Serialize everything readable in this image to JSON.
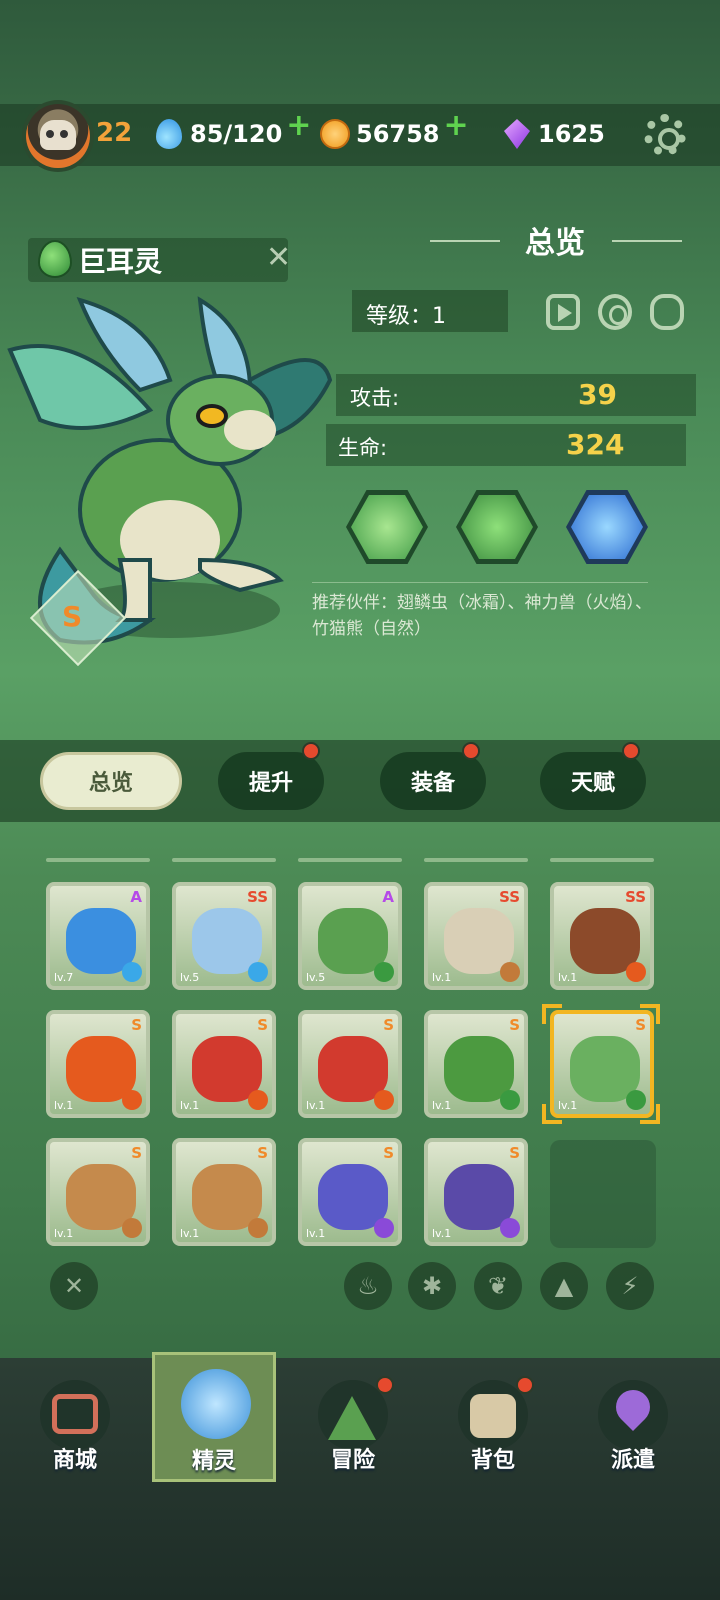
{
  "header": {
    "player_level": "22",
    "energy": "85/120",
    "coins": "56758",
    "gems": "1625"
  },
  "pet": {
    "name": "巨耳灵",
    "rank": "S",
    "element_icon": "leaf-icon"
  },
  "overview": {
    "title": "总览",
    "level_text": "等级：1",
    "attack_label": "攻击:",
    "attack_value": "39",
    "hp_label": "生命:",
    "hp_value": "324",
    "skills": [
      "wind-swirl-icon",
      "seed-drops-icon",
      "water-vortex-icon"
    ],
    "partners": "推荐伙伴：翅鳞虫（冰霜）、神力兽（火焰）、竹猫熊（自然）"
  },
  "tabs": [
    {
      "label": "总览",
      "active": true,
      "badge": false
    },
    {
      "label": "提升",
      "active": false,
      "badge": true
    },
    {
      "label": "装备",
      "active": false,
      "badge": true
    },
    {
      "label": "天赋",
      "active": false,
      "badge": true
    }
  ],
  "pets": [
    {
      "level": "lv.7",
      "rank": "A",
      "element": "ice",
      "color": "#3b8fe0"
    },
    {
      "level": "lv.5",
      "rank": "SS",
      "element": "ice",
      "color": "#9cc7ea"
    },
    {
      "level": "lv.5",
      "rank": "A",
      "element": "nature",
      "color": "#5aa050"
    },
    {
      "level": "lv.1",
      "rank": "SS",
      "element": "earth",
      "color": "#d9cfb6"
    },
    {
      "level": "lv.1",
      "rank": "SS",
      "element": "fire",
      "color": "#8c4a2a"
    },
    {
      "level": "lv.1",
      "rank": "S",
      "element": "fire",
      "color": "#e55a1e"
    },
    {
      "level": "lv.1",
      "rank": "S",
      "element": "fire",
      "color": "#d23a2e"
    },
    {
      "level": "lv.1",
      "rank": "S",
      "element": "fire",
      "color": "#d23a2e"
    },
    {
      "level": "lv.1",
      "rank": "S",
      "element": "nature",
      "color": "#4c9a40"
    },
    {
      "level": "lv.1",
      "rank": "S",
      "element": "nature",
      "color": "#6ab060"
    },
    {
      "level": "lv.1",
      "rank": "S",
      "element": "earth",
      "color": "#c58a4c"
    },
    {
      "level": "lv.1",
      "rank": "S",
      "element": "earth",
      "color": "#c58a4c"
    },
    {
      "level": "lv.1",
      "rank": "S",
      "element": "lightning",
      "color": "#5a5ac8"
    },
    {
      "level": "lv.1",
      "rank": "S",
      "element": "lightning",
      "color": "#5a4aa8"
    }
  ],
  "filters": [
    "close-filter-icon",
    "fire-filter-icon",
    "ice-filter-icon",
    "nature-filter-icon",
    "earth-filter-icon",
    "lightning-filter-icon"
  ],
  "nav": [
    {
      "label": "商城",
      "icon": "shop-icon",
      "active": false,
      "badge": false
    },
    {
      "label": "精灵",
      "icon": "spirit-icon",
      "active": true,
      "badge": false
    },
    {
      "label": "冒险",
      "icon": "adventure-icon",
      "active": false,
      "badge": true
    },
    {
      "label": "背包",
      "icon": "backpack-icon",
      "active": false,
      "badge": true
    },
    {
      "label": "派遣",
      "icon": "dispatch-icon",
      "active": false,
      "badge": false
    }
  ],
  "colors": {
    "rank_s": "#f08a2a",
    "rank_ss": "#e64a2e",
    "rank_a": "#b54ae8",
    "stat_value": "#f5d24a",
    "badge": "#e64a2e"
  }
}
